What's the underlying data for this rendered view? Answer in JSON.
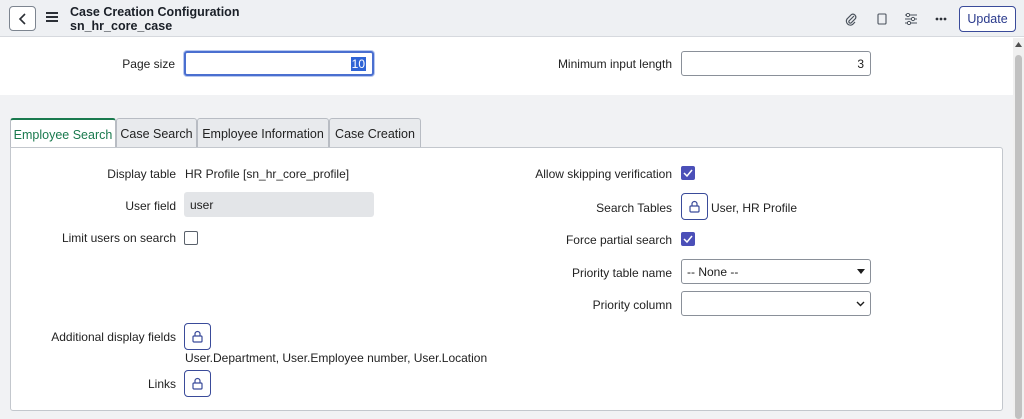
{
  "header": {
    "title": "Case Creation Configuration",
    "subtitle": "sn_hr_core_case",
    "update_label": "Update",
    "icons": [
      "paperclip-icon",
      "clipboard-icon",
      "sliders-icon",
      "more-icon"
    ]
  },
  "top": {
    "page_size_label": "Page size",
    "page_size_value": "10",
    "min_input_label": "Minimum input length",
    "min_input_value": "3"
  },
  "tabs": [
    {
      "label": "Employee Search",
      "active": true
    },
    {
      "label": "Case Search",
      "active": false
    },
    {
      "label": "Employee Information",
      "active": false
    },
    {
      "label": "Case Creation",
      "active": false
    }
  ],
  "form": {
    "display_table_label": "Display table",
    "display_table_value": "HR Profile [sn_hr_core_profile]",
    "user_field_label": "User field",
    "user_field_value": "user",
    "limit_users_label": "Limit users on search",
    "limit_users_checked": false,
    "additional_display_label": "Additional display fields",
    "additional_display_value": "User.Department, User.Employee number, User.Location",
    "links_label": "Links",
    "allow_skipping_label": "Allow skipping verification",
    "allow_skipping_checked": true,
    "search_tables_label": "Search Tables",
    "search_tables_value": "User, HR Profile",
    "force_partial_label": "Force partial search",
    "force_partial_checked": true,
    "priority_table_label": "Priority table name",
    "priority_table_value": "-- None --",
    "priority_column_label": "Priority column",
    "priority_column_value": ""
  },
  "colors": {
    "accent": "#2a3a8c",
    "active_tab": "#1a7a4e",
    "checkbox": "#4b4fb8"
  }
}
